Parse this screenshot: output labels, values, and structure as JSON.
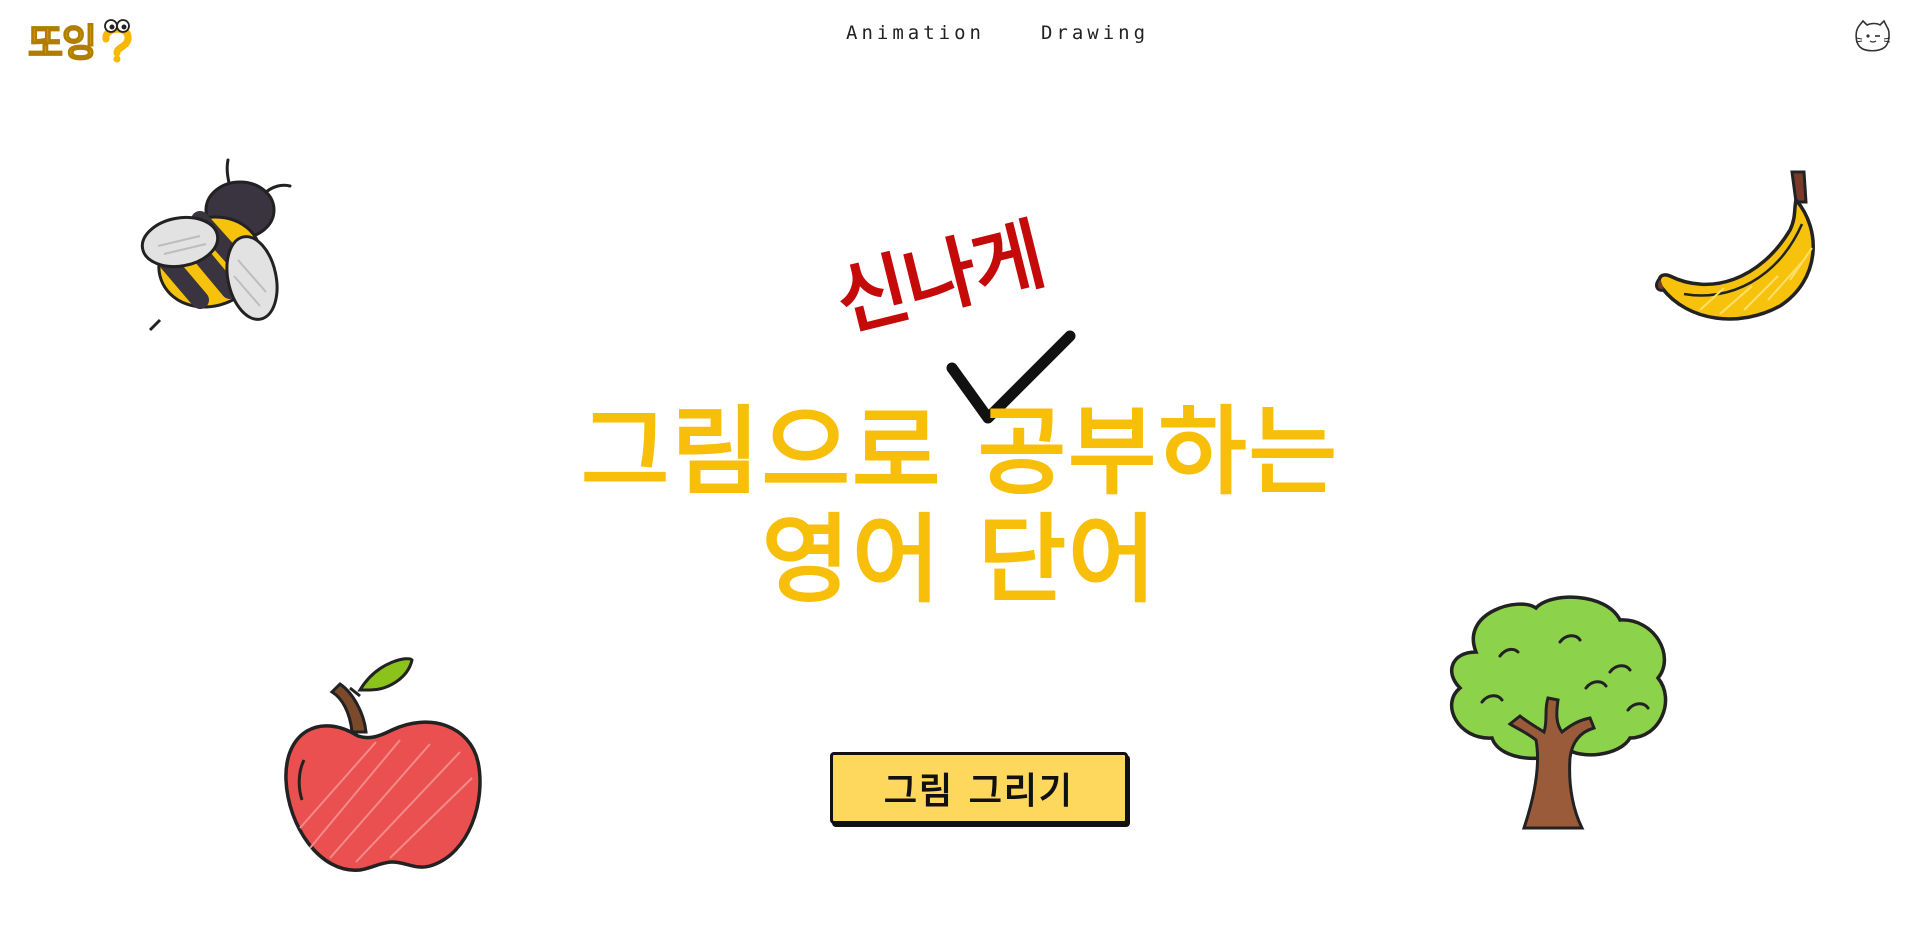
{
  "header": {
    "logo_text": "또잉",
    "nav": [
      {
        "label": "Animation"
      },
      {
        "label": "Drawing"
      }
    ]
  },
  "hero": {
    "accent_word": "신나게",
    "line1": "그림으로 공부하는",
    "line2": "영어 단어",
    "cta_label": "그림 그리기"
  },
  "colors": {
    "brand_yellow": "#f8bf0a",
    "accent_red": "#c50a0a",
    "button_yellow": "#fdd85c"
  },
  "illustrations": [
    "bee-icon",
    "banana-icon",
    "apple-icon",
    "tree-icon"
  ]
}
